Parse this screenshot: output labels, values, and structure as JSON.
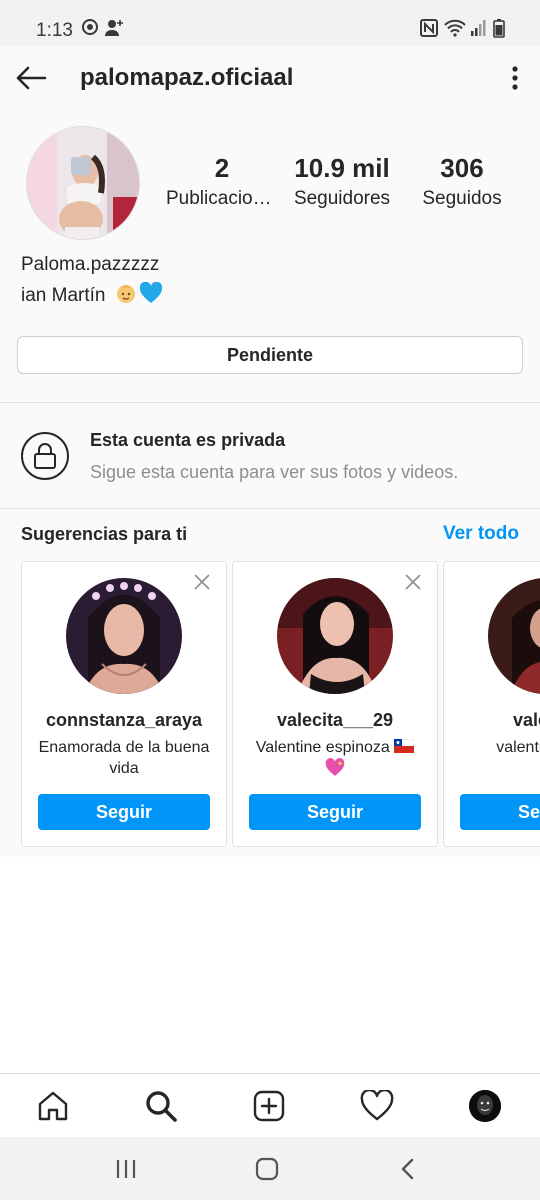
{
  "status_bar": {
    "time": "1:13",
    "icons": [
      "record-icon",
      "person-add-icon",
      "nfc-icon",
      "wifi-icon",
      "signal-icon",
      "battery-icon"
    ]
  },
  "header": {
    "username": "palomapaz.oficiaal",
    "back_icon": "arrow-left-icon",
    "more_icon": "more-vertical-icon"
  },
  "profile": {
    "stats": [
      {
        "number": "2",
        "label": "Publicaciones"
      },
      {
        "number": "10.9 mil",
        "label": "Seguidores"
      },
      {
        "number": "306",
        "label": "Seguidos"
      }
    ],
    "name": "Paloma.pazzzzz",
    "bio": "ian Martín",
    "bio_emojis": [
      "baby-emoji",
      "blue-heart-emoji"
    ],
    "pending_button": "Pendiente"
  },
  "private_notice": {
    "title": "Esta cuenta es privada",
    "subtitle": "Sigue esta cuenta para ver sus fotos y videos."
  },
  "suggestions": {
    "title": "Sugerencias para ti",
    "see_all": "Ver todo",
    "cards": [
      {
        "username": "connstanza_araya",
        "description": "Enamorada de la buena vida",
        "follow": "Seguir"
      },
      {
        "username": "valecita___29",
        "description": "Valentine espinoza",
        "follow": "Seguir"
      },
      {
        "username": "valecita",
        "description": "valentina resp",
        "follow": "Seguir"
      }
    ]
  },
  "bottom_nav": {
    "items": [
      "home-icon",
      "search-icon",
      "new-post-icon",
      "activity-heart-icon",
      "profile-avatar"
    ]
  },
  "system_nav": {
    "items": [
      "recents-icon",
      "home-circle-icon",
      "back-chevron-icon"
    ]
  },
  "colors": {
    "accent": "#0095f6",
    "text": "#262626",
    "secondary_text": "#8e8e8e",
    "background": "#fafafa"
  }
}
